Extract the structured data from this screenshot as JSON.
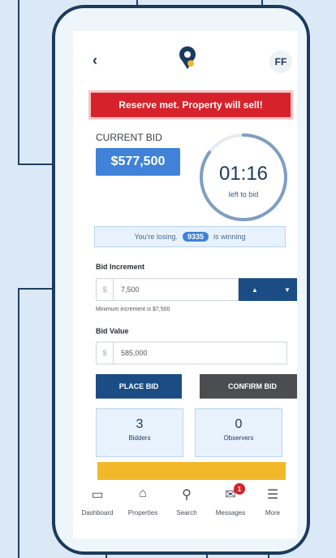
{
  "header": {
    "back_icon": "chevron-left-icon",
    "avatar_initials": "FF"
  },
  "banner": {
    "text": "Reserve met. Property will sell!"
  },
  "bid": {
    "label": "CURRENT BID",
    "value": "$577,500"
  },
  "timer": {
    "time": "01:16",
    "subtitle": "left to bid",
    "ring_fraction": 0.85
  },
  "status": {
    "prefix": "You're losing.",
    "bidder_id": "9335",
    "suffix": "is winning"
  },
  "increment": {
    "label": "Bid Increment",
    "currency": "$",
    "value": "7,500",
    "hint": "Minimum increment is $7,500",
    "up_icon": "arrow-up-icon",
    "down_icon": "arrow-down-icon"
  },
  "bid_value": {
    "label": "Bid Value",
    "currency": "$",
    "value": "585,000"
  },
  "actions": {
    "place_bid": "PLACE BID",
    "confirm_bid": "CONFIRM BID"
  },
  "stats": [
    {
      "value": "3",
      "label": "Bidders"
    },
    {
      "value": "0",
      "label": "Observers"
    }
  ],
  "nav": [
    {
      "label": "Dashboard",
      "icon": "dashboard-icon"
    },
    {
      "label": "Properties",
      "icon": "home-icon"
    },
    {
      "label": "Search",
      "icon": "search-icon"
    },
    {
      "label": "Messages",
      "icon": "mail-icon",
      "badge": "1"
    },
    {
      "label": "More",
      "icon": "menu-icon"
    }
  ],
  "colors": {
    "navy": "#1b3a5e",
    "blue": "#3f82d8",
    "red": "#d7222b",
    "dark_button": "#4b4d51",
    "yellow": "#f1b92a"
  }
}
